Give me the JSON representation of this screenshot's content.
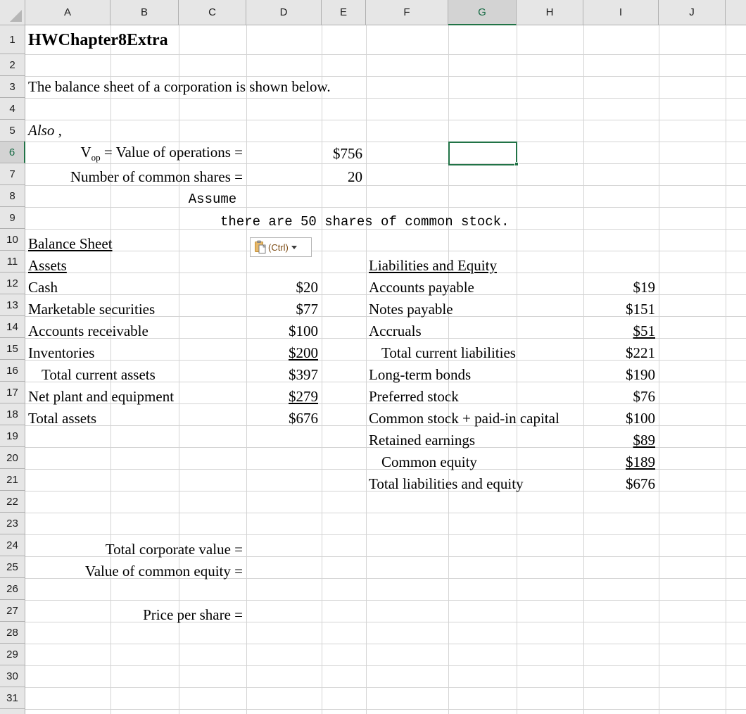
{
  "app": "excel-worksheet",
  "grid": {
    "columns": [
      "A",
      "B",
      "C",
      "D",
      "E",
      "F",
      "G",
      "H",
      "I",
      "J"
    ],
    "rows": [
      "1",
      "2",
      "3",
      "4",
      "5",
      "6",
      "7",
      "8",
      "9",
      "10",
      "11",
      "12",
      "13",
      "14",
      "15",
      "16",
      "17",
      "18",
      "19",
      "20",
      "21",
      "22",
      "23",
      "24",
      "25",
      "26",
      "27",
      "28",
      "29",
      "30",
      "31"
    ],
    "selected_cell": "G6",
    "selected_column": "G",
    "selected_row": "6",
    "accent_color": "#217346",
    "header_fill": "#e6e6e6",
    "header_selected_fill": "#d3d3d3",
    "gridline_color": "#d4d4d4"
  },
  "cells": {
    "a1_title": "HWChapter8Extra",
    "a3_intro": "The balance sheet of a corporation is shown below.",
    "a5_also": "Also ,",
    "b6_label": "V|op| = Value of operations =",
    "b6_label_main": "V",
    "b6_label_sub": "op",
    "b6_label_rest": " = Value of operations =",
    "e6_value": "$756",
    "b7_label": "Number of common shares =",
    "e7_value": "20",
    "c8_assume": "Assume",
    "c9_note": "there are 50 shares of common stock.",
    "a10_balance_sheet": "Balance Sheet",
    "a11_assets": "Assets",
    "f11_liabilities": "Liabilities and Equity",
    "a12_cash": "Cash",
    "d12_cash": "$20",
    "f12_accounts_payable": "Accounts payable",
    "i12_accounts_payable": "$19",
    "a13_marketable": "Marketable securities",
    "d13_marketable": "$77",
    "f13_notes_payable": "Notes payable",
    "i13_notes_payable": "$151",
    "a14_receivable": "Accounts receivable",
    "d14_receivable": "$100",
    "f14_accruals": "Accruals",
    "i14_accruals": "$51",
    "a15_inventories": "Inventories",
    "d15_inventories": "$200",
    "f15_total_current_liab": "Total current liabilities",
    "i15_total_current_liab": "$221",
    "a16_total_current_assets": "Total current assets",
    "d16_total_current_assets": "$397",
    "f16_longterm_bonds": "Long-term bonds",
    "i16_longterm_bonds": "$190",
    "a17_net_plant": "Net plant and equipment",
    "d17_net_plant": "$279",
    "f17_preferred_stock": "Preferred stock",
    "i17_preferred_stock": "$76",
    "a18_total_assets": "Total assets",
    "d18_total_assets": "$676",
    "f18_common_stock": "Common stock + paid-in capital",
    "i18_common_stock": "$100",
    "f19_retained_earnings": "Retained earnings",
    "i19_retained_earnings": "$89",
    "f20_common_equity": "Common equity",
    "i20_common_equity": "$189",
    "f21_total_liab_equity": "Total liabilities and equity",
    "i21_total_liab_equity": "$676",
    "b24_total_corporate_value": "Total corporate value =",
    "b25_value_common_equity": "Value of common equity =",
    "b27_price_per_share": "Price per share ="
  },
  "paste_options": {
    "label": "(Ctrl)",
    "icon": "clipboard-icon",
    "caret": "chevron-down-icon"
  }
}
